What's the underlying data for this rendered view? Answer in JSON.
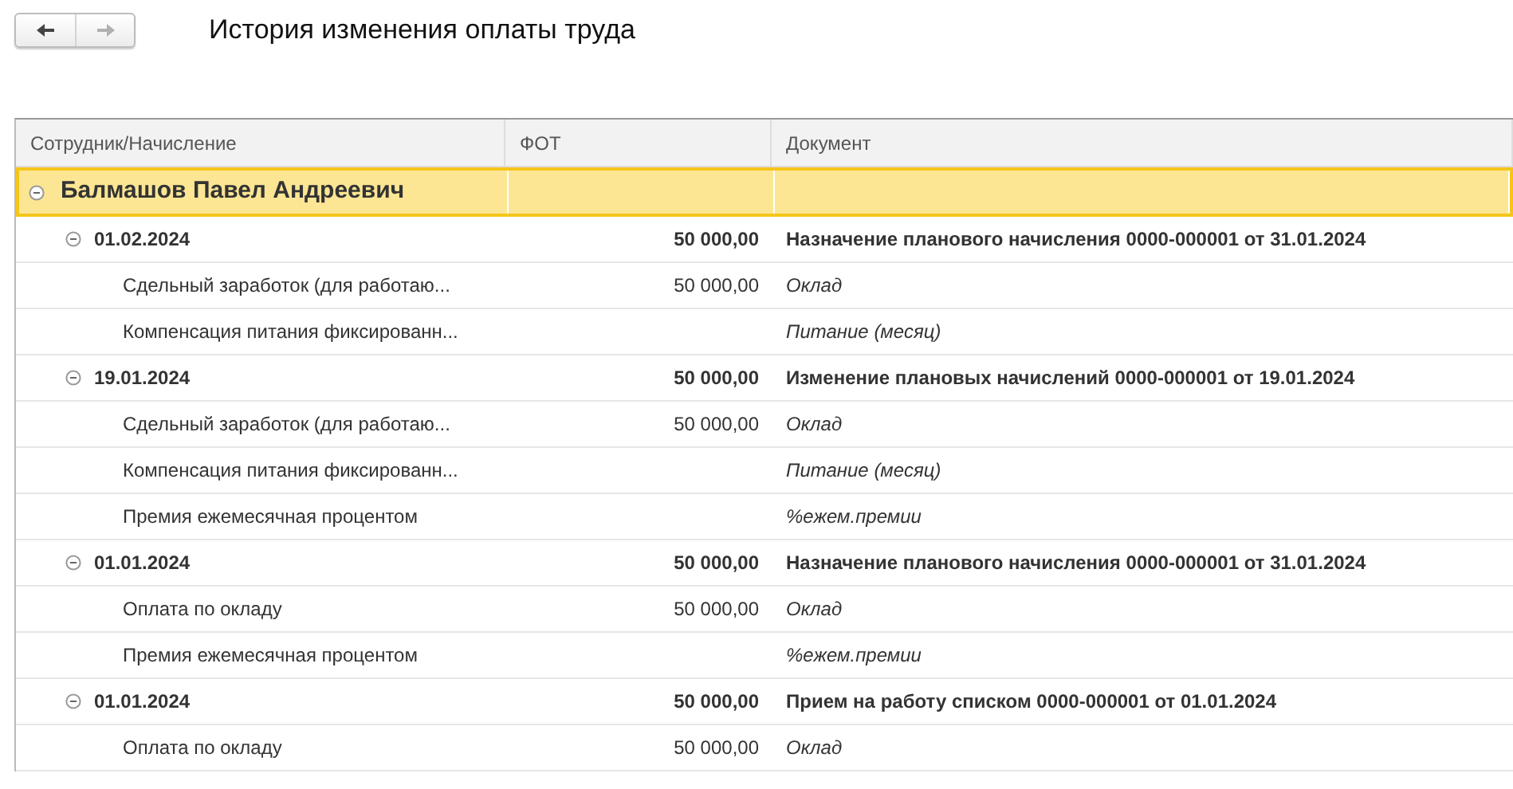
{
  "toolbar": {
    "buttons": [
      {
        "kind": "back",
        "disabled": false
      },
      {
        "kind": "forward",
        "disabled": true
      }
    ],
    "title": "История изменения оплаты труда"
  },
  "table": {
    "columns": [
      "Сотрудник/Начисление",
      "ФОТ",
      "Документ"
    ],
    "rows": [
      {
        "name": "Балмашов Павел Андреевич",
        "expanded": true,
        "selected": true,
        "children": [
          {
            "name": "01.02.2024",
            "fot": "50 000,00",
            "document": "Назначение планового начисления 0000-000001 от 31.01.2024",
            "expanded": true,
            "selected": false,
            "children": [
              {
                "name": "Сдельный заработок (для работаю...",
                "fot": "50 000,00",
                "document": "Оклад",
                "selected": false
              },
              {
                "name": "Компенсация питания фиксированн...",
                "document": "Питание (месяц)",
                "selected": false
              }
            ]
          },
          {
            "name": "19.01.2024",
            "fot": "50 000,00",
            "document": "Изменение плановых начислений 0000-000001 от 19.01.2024",
            "expanded": true,
            "selected": false,
            "children": [
              {
                "name": "Сдельный заработок (для работаю...",
                "fot": "50 000,00",
                "document": "Оклад",
                "selected": false
              },
              {
                "name": "Компенсация питания фиксированн...",
                "document": "Питание (месяц)",
                "selected": false
              },
              {
                "name": "Премия ежемесячная процентом",
                "document": "%ежем.премии",
                "selected": false
              }
            ]
          },
          {
            "name": "01.01.2024",
            "fot": "50 000,00",
            "document": "Назначение планового начисления 0000-000001 от 31.01.2024",
            "expanded": true,
            "selected": false,
            "children": [
              {
                "name": "Оплата по окладу",
                "fot": "50 000,00",
                "document": "Оклад",
                "selected": false
              },
              {
                "name": "Премия ежемесячная процентом",
                "document": "%ежем.премии",
                "selected": false
              }
            ]
          },
          {
            "name": "01.01.2024",
            "fot": "50 000,00",
            "document": "Прием на работу списком 0000-000001 от 01.01.2024",
            "expanded": true,
            "selected": false,
            "children": [
              {
                "name": "Оплата по окладу",
                "fot": "50 000,00",
                "document": "Оклад",
                "selected": false
              }
            ]
          }
        ]
      }
    ]
  }
}
